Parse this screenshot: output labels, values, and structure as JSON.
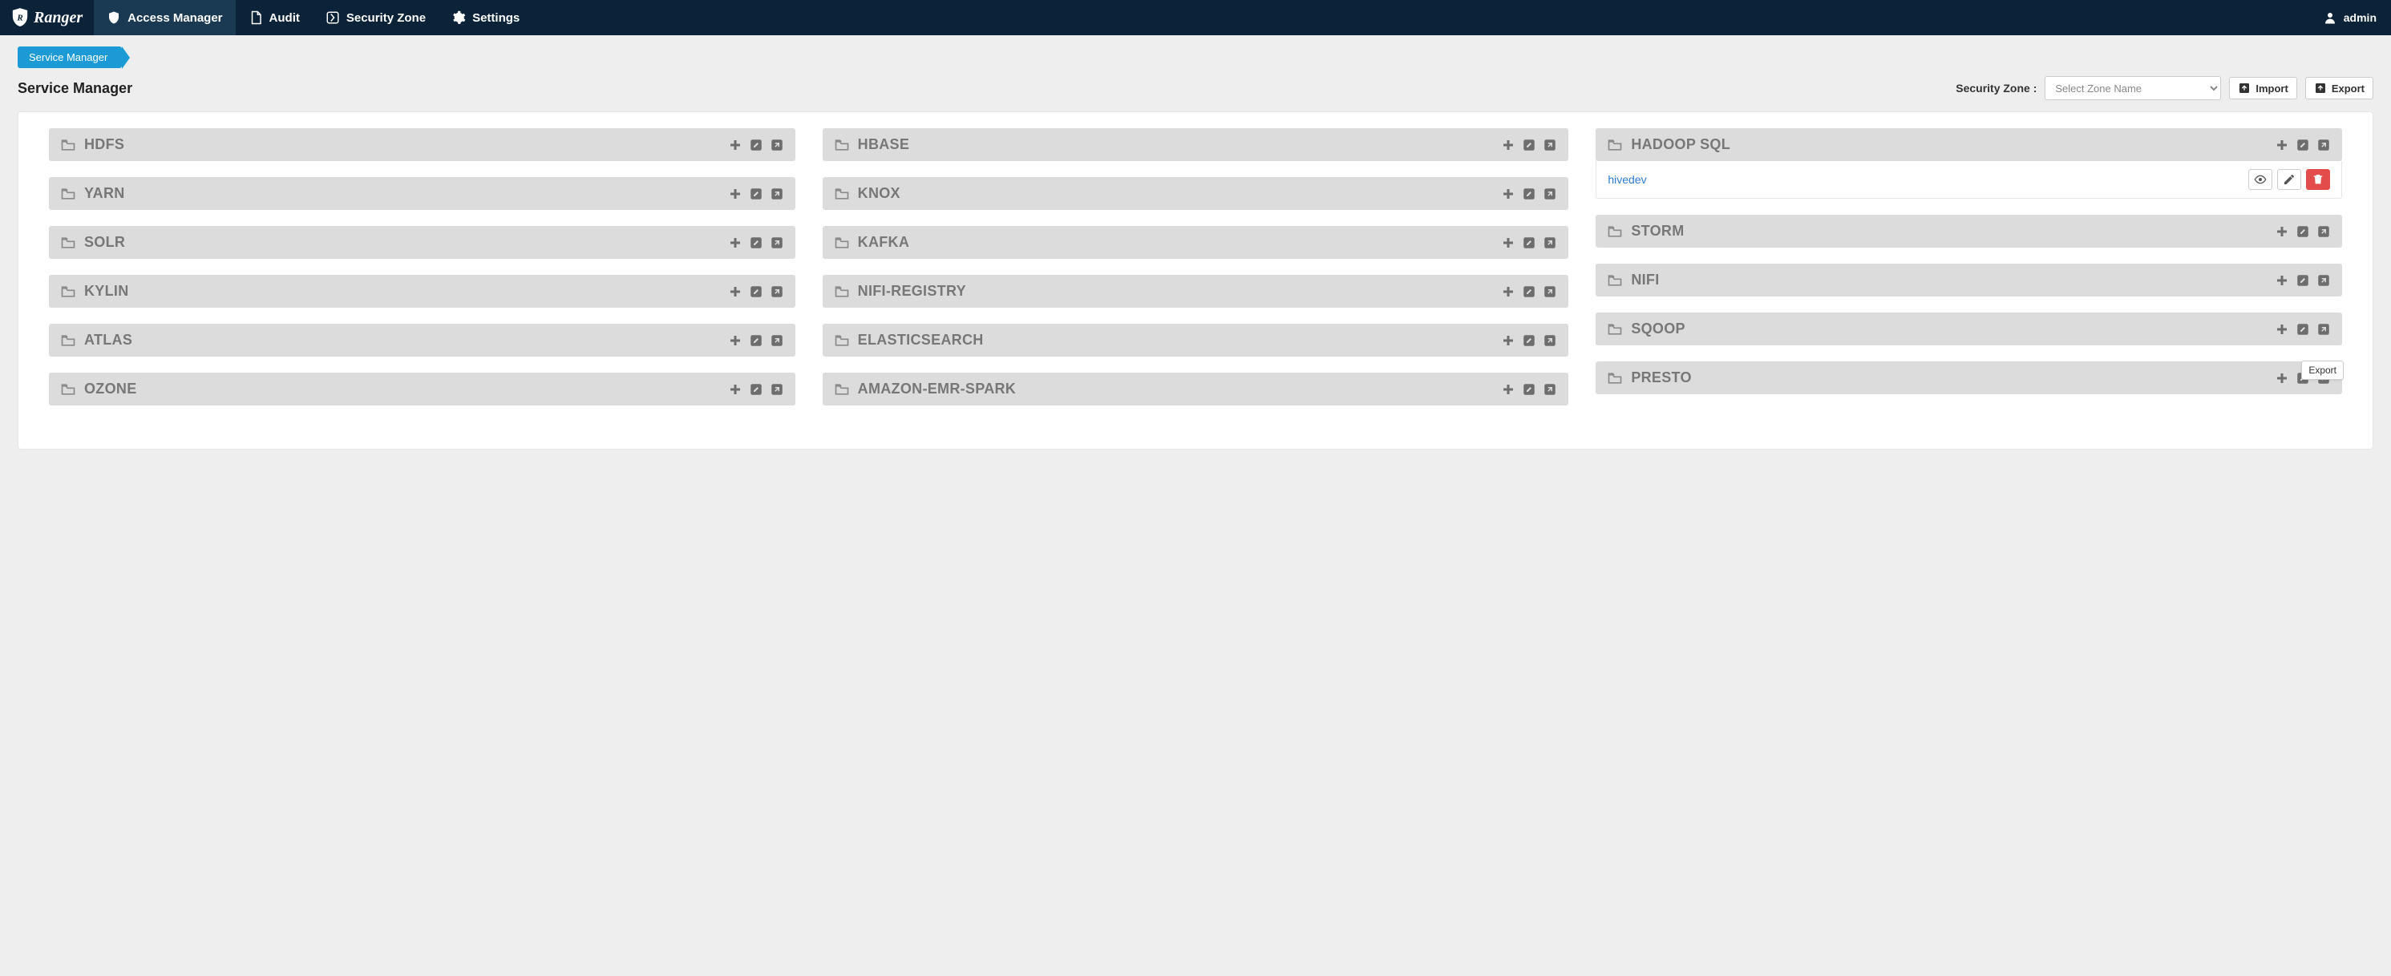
{
  "nav": {
    "brand": "Ranger",
    "items": [
      {
        "id": "access-manager",
        "label": "Access Manager",
        "icon": "shield-icon",
        "active": true
      },
      {
        "id": "audit",
        "label": "Audit",
        "icon": "file-icon",
        "active": false
      },
      {
        "id": "security-zone",
        "label": "Security Zone",
        "icon": "zone-icon",
        "active": false
      },
      {
        "id": "settings",
        "label": "Settings",
        "icon": "gear-icon",
        "active": false
      }
    ],
    "user": {
      "name": "admin"
    }
  },
  "breadcrumb": {
    "label": "Service Manager"
  },
  "page_title": "Service Manager",
  "zone": {
    "label": "Security Zone :",
    "placeholder": "Select Zone Name"
  },
  "buttons": {
    "import": "Import",
    "export": "Export"
  },
  "tooltip_export": "Export",
  "columns": [
    [
      {
        "name": "HDFS",
        "services": []
      },
      {
        "name": "YARN",
        "services": []
      },
      {
        "name": "SOLR",
        "services": []
      },
      {
        "name": "KYLIN",
        "services": []
      },
      {
        "name": "ATLAS",
        "services": []
      },
      {
        "name": "OZONE",
        "services": []
      }
    ],
    [
      {
        "name": "HBASE",
        "services": []
      },
      {
        "name": "KNOX",
        "services": []
      },
      {
        "name": "KAFKA",
        "services": []
      },
      {
        "name": "NIFI-REGISTRY",
        "services": []
      },
      {
        "name": "ELASTICSEARCH",
        "services": []
      },
      {
        "name": "AMAZON-EMR-SPARK",
        "services": []
      }
    ],
    [
      {
        "name": "HADOOP SQL",
        "services": [
          {
            "name": "hivedev"
          }
        ]
      },
      {
        "name": "STORM",
        "services": []
      },
      {
        "name": "NIFI",
        "services": []
      },
      {
        "name": "SQOOP",
        "services": []
      },
      {
        "name": "PRESTO",
        "services": []
      }
    ]
  ]
}
